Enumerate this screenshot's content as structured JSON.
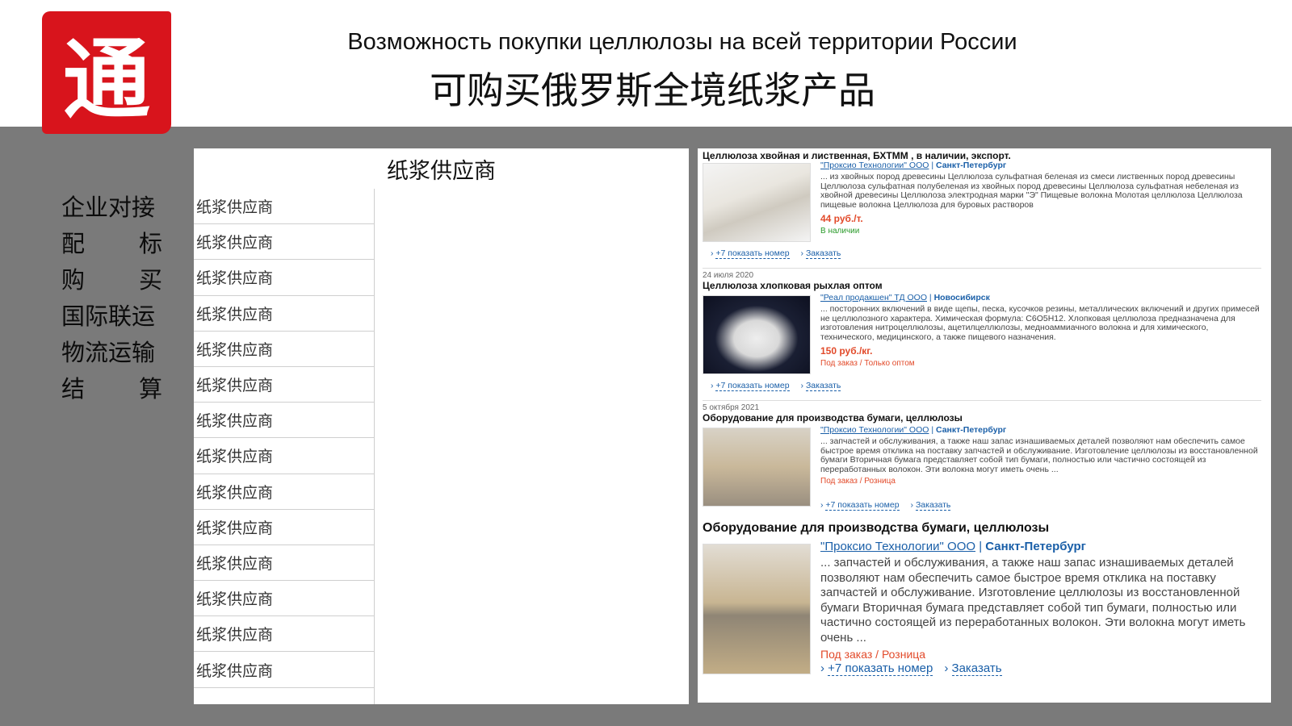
{
  "header": {
    "title_ru": "Возможность покупки целлюлозы на всей территории России",
    "title_zh": "可购买俄罗斯全境纸浆产品",
    "logo_char": "通",
    "logo_color": "#d8141c"
  },
  "menu": [
    {
      "a": "企业对接",
      "b": ""
    },
    {
      "a": "配",
      "b": "标"
    },
    {
      "a": "购",
      "b": "买"
    },
    {
      "a": "国际联运",
      "b": ""
    },
    {
      "a": "物流运输",
      "b": ""
    },
    {
      "a": "结",
      "b": "算"
    }
  ],
  "table": {
    "header": "纸浆供应商",
    "rows": [
      "纸浆供应商",
      "纸浆供应商",
      "纸浆供应商",
      "纸浆供应商",
      "纸浆供应商",
      "纸浆供应商",
      "纸浆供应商",
      "纸浆供应商",
      "纸浆供应商",
      "纸浆供应商",
      "纸浆供应商",
      "纸浆供应商",
      "纸浆供应商",
      "纸浆供应商"
    ]
  },
  "results": [
    {
      "date": "",
      "title": "Целлюлоза хвойная и лиственная, БХТММ , в наличии, экспорт.",
      "seller": "\"Проксио Технологии\" ООО",
      "city": "Санкт-Петербург",
      "desc": "... из хвойных пород древесины Целлюлоза сульфатная беленая из смеси лиственных пород древесины Целлюлоза сульфатная полубеленая из хвойных пород древесины Целлюлоза сульфатная небеленая из хвойной древесины Целлюлоза электродная марки \"Э\" Пищевые волокна Молотая целлюлоза Целлюлоза пищевые волокна Целлюлоза для буровых растворов",
      "price": "44 руб./т.",
      "status": "В наличии",
      "status_color": "#2a9a2a",
      "show_phone": "+7 показать номер",
      "order": "Заказать"
    },
    {
      "date": "24 июля 2020",
      "title": "Целлюлоза хлопковая рыхлая оптом",
      "seller": "\"Реал продакшен\" ТД ООО",
      "city": "Новосибирск",
      "desc": "... посторонних включений в виде щепы, песка, кусочков резины, металлических включений и других примесей не целлюлозного характера. Химическая формула: C6O5H12. Хлопковая целлюлоза предназначена для изготовления нитроцеллюлозы, ацетилцеллюлозы, медноаммиачного волокна и для химического, технического, медицинского, а также пищевого назначения.",
      "price": "150 руб./кг.",
      "status": "Под заказ / Только оптом",
      "status_color": "#e24a2a",
      "show_phone": "+7 показать номер",
      "order": "Заказать"
    },
    {
      "date": "5 октября 2021",
      "title": "Оборудование для производства бумаги, целлюлозы",
      "seller": "\"Проксио Технологии\" ООО",
      "city": "Санкт-Петербург",
      "desc": "... запчастей и обслуживания, а также наш запас изнашиваемых деталей позволяют нам обеспечить самое быстрое время отклика на поставку запчастей и обслуживание. Изготовление целлюлозы из восстановленной бумаги Вторичная бумага представляет собой тип бумаги, полностью или частично состоящей из переработанных волокон. Эти волокна могут иметь очень ...",
      "price": "",
      "status": "Под заказ / Розница",
      "status_color": "#e24a2a",
      "show_phone": "+7 показать номер",
      "order": "Заказать"
    },
    {
      "date": "",
      "title": "Оборудование для производства бумаги, целлюлозы",
      "seller": "\"Проксио Технологии\" ООО",
      "city": "Санкт-Петербург",
      "desc": "... запчастей и обслуживания, а также наш запас изнашиваемых деталей позволяют нам обеспечить самое быстрое время отклика на поставку запчастей и обслуживание. Изготовление целлюлозы из восстановленной бумаги Вторичная бумага представляет собой тип бумаги, полностью или частично состоящей из переработанных волокон. Эти волокна могут иметь очень ...",
      "price": "",
      "status": "Под заказ / Розница",
      "status_color": "#e24a2a",
      "show_phone": "+7 показать номер",
      "order": "Заказать"
    }
  ]
}
